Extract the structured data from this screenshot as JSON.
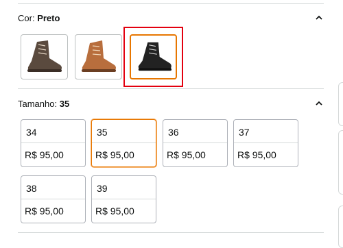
{
  "color_section": {
    "label": "Cor:",
    "value": "Preto",
    "swatches": [
      {
        "color_name": "brown",
        "boot_color": "#5a4a3e"
      },
      {
        "color_name": "tan",
        "boot_color": "#b86e3d"
      },
      {
        "color_name": "black",
        "boot_color": "#222222"
      }
    ],
    "selected_index": 2,
    "collapse_icon": "chevron-up-icon"
  },
  "size_section": {
    "label": "Tamanho:",
    "value": "35",
    "collapse_icon": "chevron-up-icon",
    "options": [
      {
        "size": "34",
        "price": "R$ 95,00"
      },
      {
        "size": "35",
        "price": "R$ 95,00"
      },
      {
        "size": "36",
        "price": "R$ 95,00"
      },
      {
        "size": "37",
        "price": "R$ 95,00"
      },
      {
        "size": "38",
        "price": "R$ 95,00"
      },
      {
        "size": "39",
        "price": "R$ 95,00"
      }
    ]
  },
  "colors": {
    "selected_border": "#e77600",
    "highlight_box": "#e3000f",
    "divider": "#d5d9d9"
  }
}
